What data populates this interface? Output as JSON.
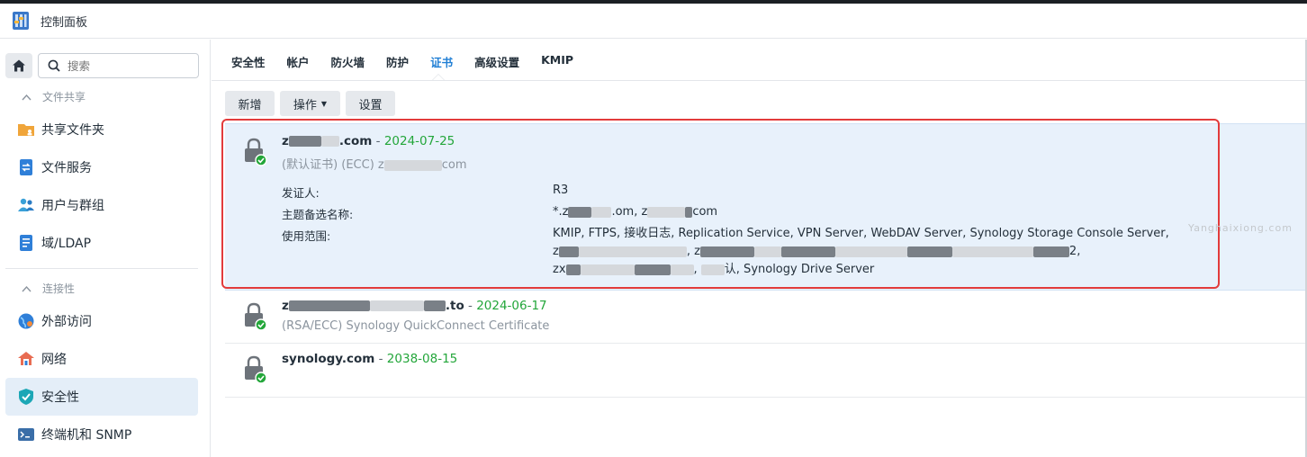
{
  "app": {
    "title": "控制面板"
  },
  "search": {
    "placeholder": "搜索"
  },
  "sidebar": {
    "sections": [
      {
        "label": "文件共享"
      },
      {
        "label": "连接性"
      }
    ],
    "items": [
      {
        "label": "共享文件夹",
        "icon": "shared-folder-icon"
      },
      {
        "label": "文件服务",
        "icon": "file-services-icon"
      },
      {
        "label": "用户与群组",
        "icon": "users-groups-icon"
      },
      {
        "label": "域/LDAP",
        "icon": "domain-ldap-icon"
      },
      {
        "label": "外部访问",
        "icon": "external-access-icon"
      },
      {
        "label": "网络",
        "icon": "network-icon"
      },
      {
        "label": "安全性",
        "icon": "security-shield-icon",
        "active": true
      },
      {
        "label": "终端机和 SNMP",
        "icon": "terminal-icon"
      }
    ]
  },
  "tabs": [
    {
      "label": "安全性"
    },
    {
      "label": "帐户"
    },
    {
      "label": "防火墙"
    },
    {
      "label": "防护"
    },
    {
      "label": "证书",
      "active": true
    },
    {
      "label": "高级设置"
    },
    {
      "label": "KMIP"
    }
  ],
  "toolbar": {
    "add_label": "新增",
    "action_label": "操作",
    "settings_label": "设置"
  },
  "certificates": [
    {
      "name_prefix": "z",
      "name_suffix": ".com",
      "dash": " - ",
      "date": "2024-07-25",
      "subtitle_prefix": "(默认证书) (ECC) z",
      "subtitle_suffix": "com",
      "details": {
        "issuer_label": "发证人:",
        "issuer_value": "R3",
        "san_label": "主题备选名称:",
        "san_part1": "*.z",
        "san_part2": ".om, z",
        "san_part3": "com",
        "usage_label": "使用范围:",
        "usage_line1": "KMIP, FTPS, 接收日志, Replication Service, VPN Server, WebDAV Server, Synology Storage Console Server,",
        "usage_line2_a": "z",
        "usage_line2_b": ", z",
        "usage_line2_c": "2,",
        "usage_line3_a": "zx",
        "usage_line3_b": ", ",
        "usage_line3_c": "认, Synology Drive Server"
      }
    },
    {
      "name_prefix": "z",
      "name_suffix": ".to",
      "dash": " - ",
      "date": "2024-06-17",
      "subtitle": "(RSA/ECC) Synology QuickConnect Certificate"
    },
    {
      "name": "synology.com",
      "dash": " - ",
      "date": "2038-08-15"
    }
  ],
  "watermark": "Yanghaixiong.com",
  "colors": {
    "accent": "#1f7ed4",
    "date_green": "#23a63a",
    "selected_row": "#e8f1fb",
    "highlight_border": "#e23b3b"
  }
}
